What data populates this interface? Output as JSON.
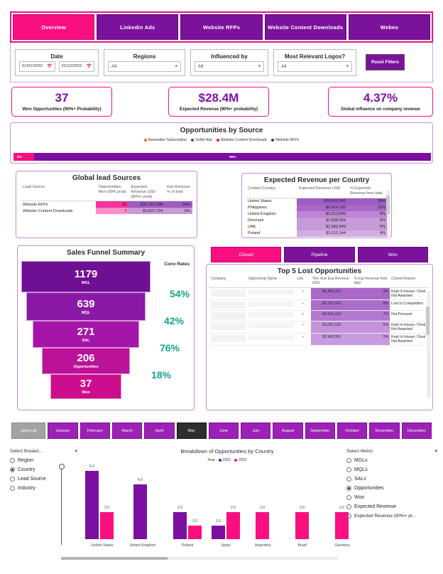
{
  "nav": {
    "tabs": [
      {
        "label": "Overview",
        "active": true
      },
      {
        "label": "Linkedin Ads",
        "active": false
      },
      {
        "label": "Website RFPs",
        "active": false
      },
      {
        "label": "Website Content Downloads",
        "active": false
      },
      {
        "label": "Webeo",
        "active": false
      }
    ]
  },
  "filters": {
    "date": {
      "label": "Date",
      "from": "01/01/2022",
      "to": "31/12/2022",
      "icon": "calendar-icon"
    },
    "regions": {
      "label": "Regions",
      "value": "All"
    },
    "influenced_by": {
      "label": "Influenced by",
      "value": "All"
    },
    "logos": {
      "label": "Most Relevant Logos?",
      "value": "All"
    },
    "reset_label": "Reset Filters"
  },
  "kpis": [
    {
      "value": "37",
      "label": "Won Opportunities (90%+ Probability)"
    },
    {
      "value": "$28.4M",
      "label": "Expected Revenue (90%+ probability)"
    },
    {
      "value": "4.37%",
      "label": "Global influence on company revenue"
    }
  ],
  "opportunities_by_source": {
    "title": "Opportunities by Source",
    "legend": [
      {
        "label": "Newsletter Subscription",
        "color": "#f26a1b"
      },
      {
        "label": "SoMe Ads",
        "color": "#2a4fb7"
      },
      {
        "label": "Website Content Downloads",
        "color": "#fa0f80"
      },
      {
        "label": "Website RFPs",
        "color": "#7b10a0"
      }
    ],
    "segments": [
      {
        "label": "5%",
        "pct": 5,
        "color": "#fa0f80"
      },
      {
        "label": "95%",
        "pct": 95,
        "color": "#7b10a0"
      }
    ]
  },
  "lead_sources": {
    "title": "Global lead Sources",
    "columns": [
      "Lead Source",
      "Opportunities Won (90% prob)",
      "Expected Revenue USD (90%+ prob)",
      "Exp Revenue % of total"
    ],
    "rows": [
      {
        "source": "Website RFPs",
        "won": "35",
        "revenue": "$26,752,588",
        "pct": "94%"
      },
      {
        "source": "Website Content Downloads",
        "won": "2",
        "revenue": "$1,607,724",
        "pct": "6%"
      }
    ]
  },
  "revenue_by_country": {
    "title": "Expected Revenue per Country",
    "columns": [
      "Contact Country",
      "Expected Revenue USD",
      "% Expected Revenue from total"
    ],
    "rows": [
      {
        "country": "United States",
        "revenue": "$10,911,982",
        "pct": "38%"
      },
      {
        "country": "Philippines",
        "revenue": "$6,474,156",
        "pct": "23%"
      },
      {
        "country": "United Kingdom",
        "revenue": "$2,212,846",
        "pct": "8%"
      },
      {
        "country": "Denmark",
        "revenue": "$1,838,934",
        "pct": "6%"
      },
      {
        "country": "UAE",
        "revenue": "$1,565,949",
        "pct": "6%"
      },
      {
        "country": "Poland",
        "revenue": "$1,110,144",
        "pct": "4%"
      }
    ]
  },
  "funnel": {
    "title": "Sales Funnel Summary",
    "conv_header": "Conv Rates",
    "stages": [
      {
        "value": "1179",
        "label": "MGL"
      },
      {
        "value": "639",
        "label": "MQL"
      },
      {
        "value": "271",
        "label": "SAL"
      },
      {
        "value": "206",
        "label": "Opportunities"
      },
      {
        "value": "37",
        "label": "Won"
      }
    ],
    "conv_rates": [
      "54%",
      "42%",
      "76%",
      "18%"
    ]
  },
  "status_tabs": [
    {
      "label": "Closed",
      "active": true
    },
    {
      "label": "Pipeline",
      "active": false
    },
    {
      "label": "Won",
      "active": false
    }
  ],
  "lost_opportunities": {
    "title": "Top 5 Lost Opportunities",
    "columns": [
      "Company",
      "Opportunity Name",
      "Link",
      "This Year Exp Revenue USD",
      "% Exp Revenue from total",
      "Closed Reason"
    ],
    "rows": [
      {
        "link": ">",
        "revenue": "$5,496,292",
        "pct": "9%",
        "reason": "Kept In House / Deal Not Awarded"
      },
      {
        "link": ">",
        "revenue": "$5,397,600",
        "pct": "8%",
        "reason": "Lost to Competition"
      },
      {
        "link": ">",
        "revenue": "$4,555,103",
        "pct": "7%",
        "reason": "Not Pursued"
      },
      {
        "link": ">",
        "revenue": "$3,055,150",
        "pct": "5%",
        "reason": "Kept In House / Deal Not Awarded"
      },
      {
        "link": ">",
        "revenue": "$2,998,306",
        "pct": "5%",
        "reason": "Kept In House / Deal Not Awarded"
      }
    ]
  },
  "months": [
    {
      "label": "Select all",
      "state": "all"
    },
    {
      "label": "January",
      "state": "normal"
    },
    {
      "label": "February",
      "state": "normal"
    },
    {
      "label": "March",
      "state": "normal"
    },
    {
      "label": "April",
      "state": "normal"
    },
    {
      "label": "May",
      "state": "hover"
    },
    {
      "label": "June",
      "state": "normal"
    },
    {
      "label": "July",
      "state": "normal"
    },
    {
      "label": "August",
      "state": "normal"
    },
    {
      "label": "September",
      "state": "normal"
    },
    {
      "label": "October",
      "state": "normal"
    },
    {
      "label": "November",
      "state": "normal"
    },
    {
      "label": "December",
      "state": "normal"
    }
  ],
  "breakdown_selector": {
    "label": "Select Breakd...",
    "options": [
      {
        "label": "Region",
        "selected": false
      },
      {
        "label": "Country",
        "selected": true
      },
      {
        "label": "Lead Source",
        "selected": false
      },
      {
        "label": "Industry",
        "selected": false
      }
    ]
  },
  "metric_selector": {
    "label": "Select Metric",
    "options": [
      {
        "label": "MGLs",
        "selected": false
      },
      {
        "label": "MQLs",
        "selected": false
      },
      {
        "label": "SALs",
        "selected": false
      },
      {
        "label": "Opportunities",
        "selected": true
      },
      {
        "label": "Won",
        "selected": false
      },
      {
        "label": "Expected Revenue",
        "selected": false
      },
      {
        "label": "Expected Revenue (90%+ pr...",
        "selected": false
      }
    ]
  },
  "chart_data": {
    "type": "bar",
    "title": "Breakdown of Opportunities by Country",
    "legend_title": "Year",
    "legend_position": "top-center",
    "categories": [
      "United States",
      "United Kingdom",
      "Poland",
      "Spain",
      "Argentina",
      "Brazil",
      "Germany"
    ],
    "series": [
      {
        "name": "2021",
        "color": "#7b10a0",
        "values": [
          5.0,
          4.0,
          2.0,
          1.0,
          null,
          null,
          null
        ],
        "labels": [
          "5.0",
          "4.0",
          "2.0",
          "1.0",
          "",
          "",
          ""
        ]
      },
      {
        "name": "2022",
        "color": "#fa0f80",
        "values": [
          2.0,
          null,
          1.0,
          2.0,
          2.0,
          2.0,
          2.0
        ],
        "labels": [
          "2.0",
          "",
          "1.0",
          "2.0",
          "2.0",
          "2.0",
          "2.0"
        ]
      }
    ],
    "xlabel": "",
    "ylabel": "",
    "ylim": [
      0,
      5.5
    ],
    "grid": false
  }
}
